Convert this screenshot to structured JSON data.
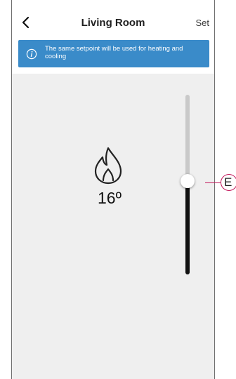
{
  "header": {
    "title": "Living Room",
    "back_icon": "chevron-left-icon",
    "set_label": "Set"
  },
  "banner": {
    "icon": "info-icon",
    "text": "The same setpoint will be used for heating and cooling",
    "color": "#3a8bc9"
  },
  "main": {
    "mode_icon": "flame-icon",
    "temperature": "16º"
  },
  "slider": {
    "level": 0.52
  },
  "callout": {
    "label": "E",
    "color": "#c2185b"
  }
}
